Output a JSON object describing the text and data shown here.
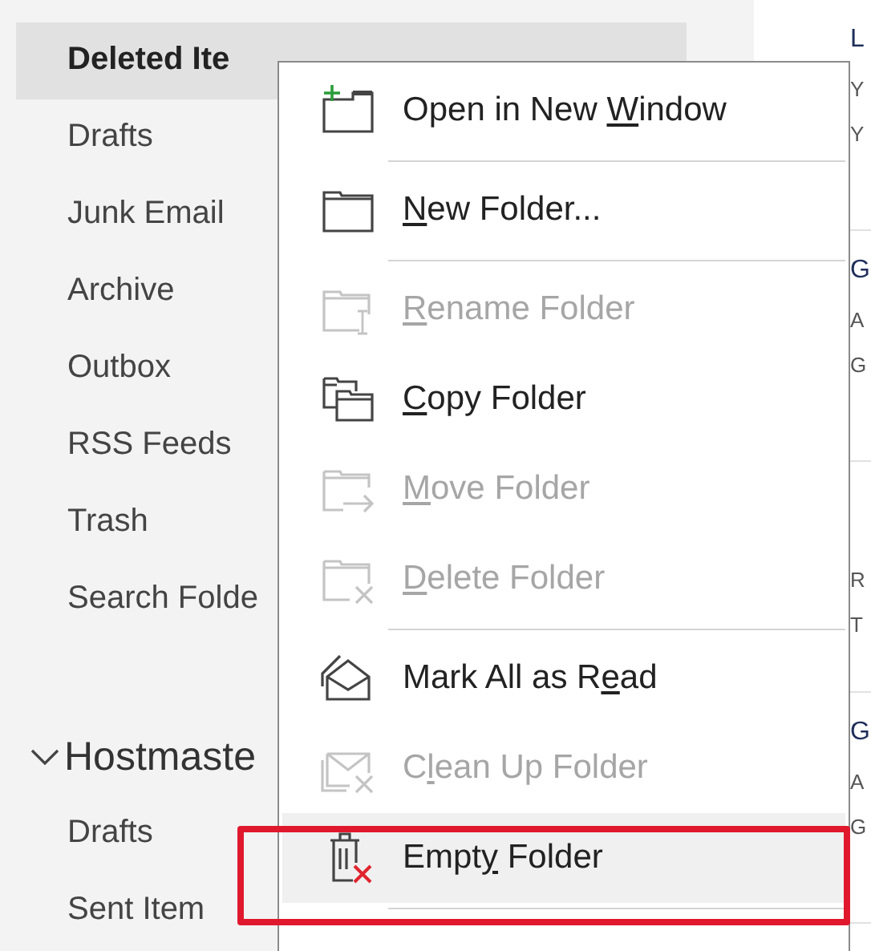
{
  "sidebar": {
    "items": [
      {
        "label": "Deleted Ite",
        "selected": true
      },
      {
        "label": "Drafts",
        "selected": false
      },
      {
        "label": "Junk Email",
        "selected": false
      },
      {
        "label": "Archive",
        "selected": false
      },
      {
        "label": "Outbox",
        "selected": false
      },
      {
        "label": "RSS Feeds",
        "selected": false
      },
      {
        "label": "Trash",
        "selected": false
      },
      {
        "label": "Search Folde",
        "selected": false
      }
    ],
    "account": {
      "label": "Hostmaste",
      "expanded": true,
      "items": [
        {
          "label": "Drafts",
          "selected": false
        },
        {
          "label": "Sent Item",
          "selected": false
        }
      ]
    }
  },
  "message_list": {
    "rows": [
      {
        "title": "L",
        "lines": [
          "Y",
          "Y"
        ]
      },
      {
        "title": "G",
        "lines": [
          "A",
          "G"
        ]
      },
      {
        "lines": [
          "R",
          "T"
        ]
      },
      {
        "title": "G",
        "lines": [
          "A",
          "G"
        ]
      }
    ]
  },
  "context_menu": {
    "items": [
      {
        "kind": "item",
        "label_start": "Open in New ",
        "access_key": "W",
        "label_end": "indow",
        "disabled": false,
        "highlighted": false,
        "annotated": false
      },
      {
        "kind": "separator"
      },
      {
        "kind": "item",
        "access_key": "N",
        "label_end": "ew Folder...",
        "disabled": false,
        "highlighted": false,
        "annotated": false
      },
      {
        "kind": "separator"
      },
      {
        "kind": "item",
        "access_key": "R",
        "label_end": "ename Folder",
        "disabled": true,
        "highlighted": false,
        "annotated": false
      },
      {
        "kind": "item",
        "access_key": "C",
        "label_end": "opy Folder",
        "disabled": false,
        "highlighted": false,
        "annotated": false
      },
      {
        "kind": "item",
        "access_key": "M",
        "label_end": "ove Folder",
        "disabled": true,
        "highlighted": false,
        "annotated": false
      },
      {
        "kind": "item",
        "access_key": "D",
        "label_end": "elete Folder",
        "disabled": true,
        "highlighted": false,
        "annotated": false
      },
      {
        "kind": "separator"
      },
      {
        "kind": "item",
        "label_start": "Mark All as R",
        "access_key": "e",
        "label_end": "ad",
        "disabled": false,
        "highlighted": false,
        "annotated": false
      },
      {
        "kind": "item",
        "label_start": "C",
        "access_key": "l",
        "label_end": "ean Up Folder",
        "disabled": true,
        "highlighted": false,
        "annotated": false
      },
      {
        "kind": "item",
        "label_start": "Empt",
        "access_key": "y",
        "label_end": " Folder",
        "disabled": false,
        "highlighted": true,
        "annotated": true
      },
      {
        "kind": "separator"
      }
    ]
  }
}
